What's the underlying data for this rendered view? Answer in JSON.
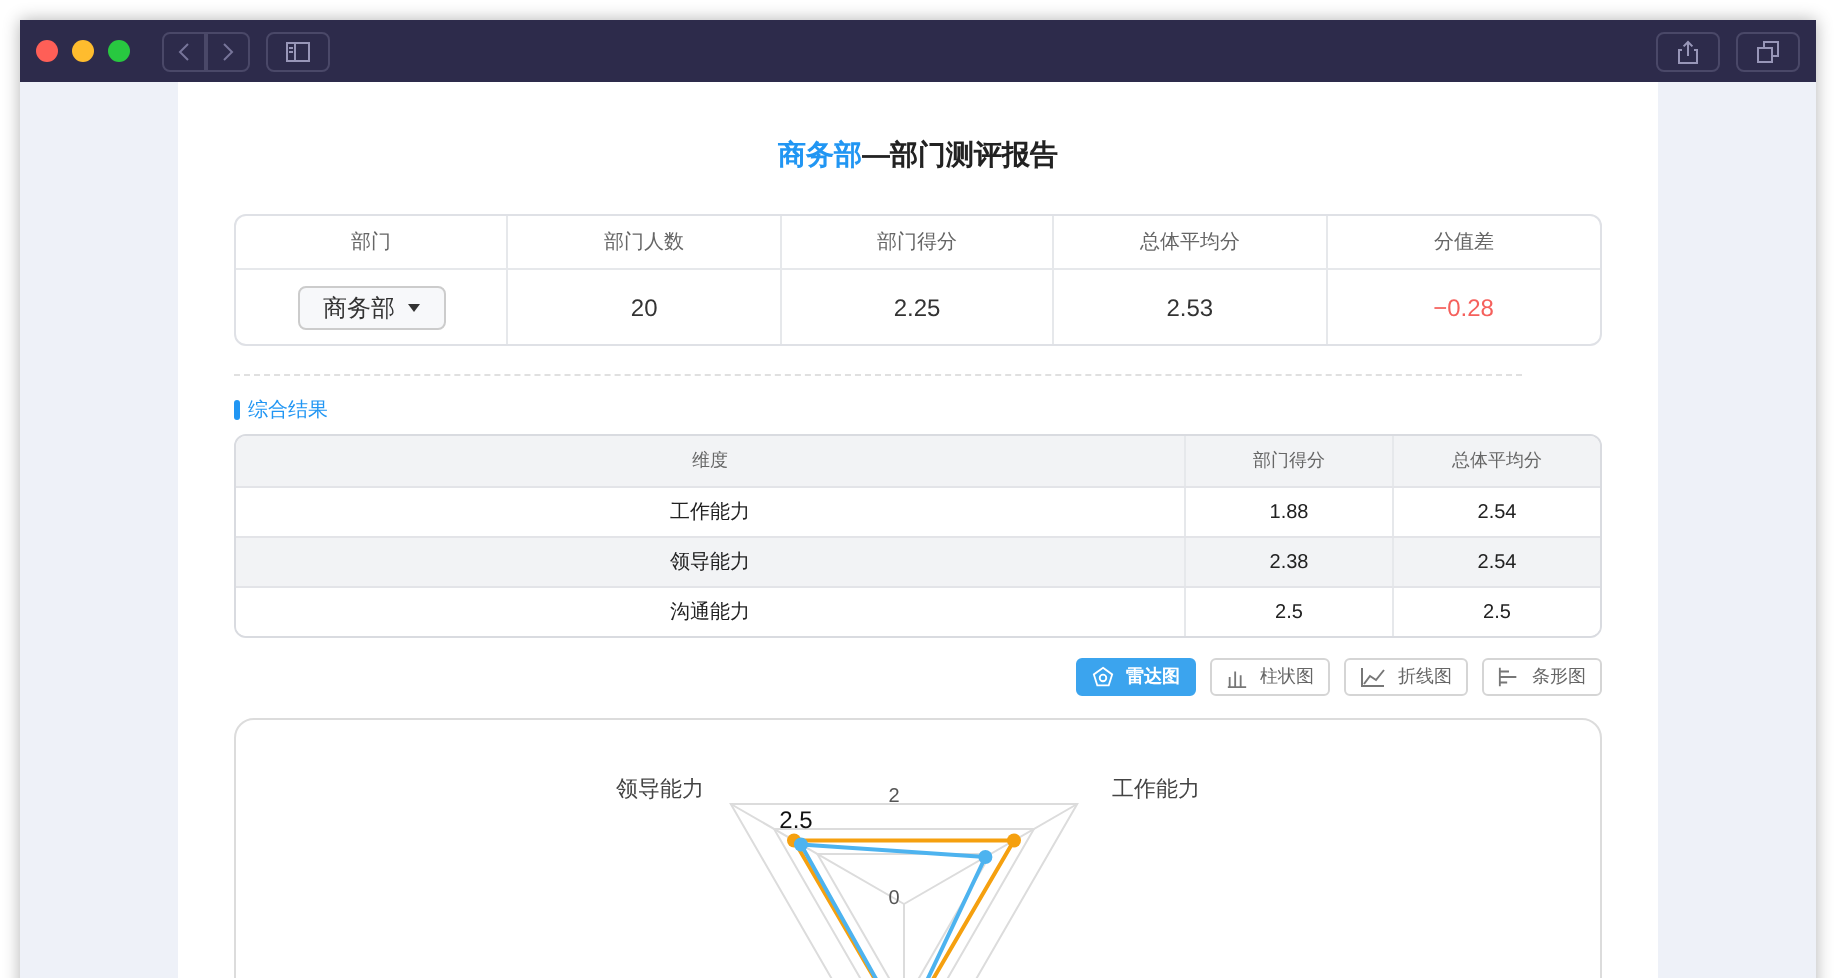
{
  "report": {
    "title_highlight": "商务部",
    "title_rest": "—部门测评报告"
  },
  "summary": {
    "columns": [
      "部门",
      "部门人数",
      "部门得分",
      "总体平均分",
      "分值差"
    ],
    "row": {
      "department": "商务部",
      "headcount": "20",
      "dept_score": "2.25",
      "overall_avg": "2.53",
      "difference": "−0.28"
    }
  },
  "section_title": "综合结果",
  "results": {
    "columns": [
      "维度",
      "部门得分",
      "总体平均分"
    ],
    "rows": [
      {
        "dimension": "工作能力",
        "dept_score": "1.88",
        "overall_avg": "2.54"
      },
      {
        "dimension": "领导能力",
        "dept_score": "2.38",
        "overall_avg": "2.54"
      },
      {
        "dimension": "沟通能力",
        "dept_score": "2.5",
        "overall_avg": "2.5"
      }
    ]
  },
  "chart_tabs": [
    {
      "label": "雷达图",
      "kind": "radar",
      "selected": true
    },
    {
      "label": "柱状图",
      "kind": "bar",
      "selected": false
    },
    {
      "label": "折线图",
      "kind": "line",
      "selected": false
    },
    {
      "label": "条形图",
      "kind": "hbar",
      "selected": false
    }
  ],
  "radar": {
    "axis_labels": [
      "领导能力",
      "工作能力"
    ],
    "tick_labels": [
      "2",
      "0"
    ],
    "data_label": "2.5"
  }
}
